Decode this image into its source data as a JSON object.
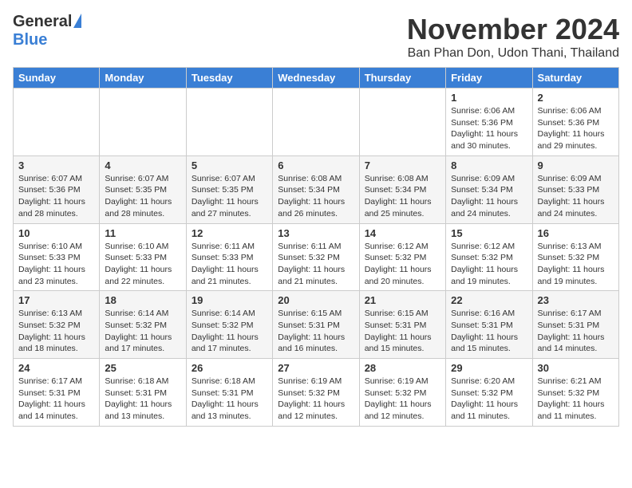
{
  "logo": {
    "general": "General",
    "blue": "Blue"
  },
  "title": "November 2024",
  "location": "Ban Phan Don, Udon Thani, Thailand",
  "weekdays": [
    "Sunday",
    "Monday",
    "Tuesday",
    "Wednesday",
    "Thursday",
    "Friday",
    "Saturday"
  ],
  "weeks": [
    [
      {
        "day": "",
        "info": ""
      },
      {
        "day": "",
        "info": ""
      },
      {
        "day": "",
        "info": ""
      },
      {
        "day": "",
        "info": ""
      },
      {
        "day": "",
        "info": ""
      },
      {
        "day": "1",
        "info": "Sunrise: 6:06 AM\nSunset: 5:36 PM\nDaylight: 11 hours\nand 30 minutes."
      },
      {
        "day": "2",
        "info": "Sunrise: 6:06 AM\nSunset: 5:36 PM\nDaylight: 11 hours\nand 29 minutes."
      }
    ],
    [
      {
        "day": "3",
        "info": "Sunrise: 6:07 AM\nSunset: 5:36 PM\nDaylight: 11 hours\nand 28 minutes."
      },
      {
        "day": "4",
        "info": "Sunrise: 6:07 AM\nSunset: 5:35 PM\nDaylight: 11 hours\nand 28 minutes."
      },
      {
        "day": "5",
        "info": "Sunrise: 6:07 AM\nSunset: 5:35 PM\nDaylight: 11 hours\nand 27 minutes."
      },
      {
        "day": "6",
        "info": "Sunrise: 6:08 AM\nSunset: 5:34 PM\nDaylight: 11 hours\nand 26 minutes."
      },
      {
        "day": "7",
        "info": "Sunrise: 6:08 AM\nSunset: 5:34 PM\nDaylight: 11 hours\nand 25 minutes."
      },
      {
        "day": "8",
        "info": "Sunrise: 6:09 AM\nSunset: 5:34 PM\nDaylight: 11 hours\nand 24 minutes."
      },
      {
        "day": "9",
        "info": "Sunrise: 6:09 AM\nSunset: 5:33 PM\nDaylight: 11 hours\nand 24 minutes."
      }
    ],
    [
      {
        "day": "10",
        "info": "Sunrise: 6:10 AM\nSunset: 5:33 PM\nDaylight: 11 hours\nand 23 minutes."
      },
      {
        "day": "11",
        "info": "Sunrise: 6:10 AM\nSunset: 5:33 PM\nDaylight: 11 hours\nand 22 minutes."
      },
      {
        "day": "12",
        "info": "Sunrise: 6:11 AM\nSunset: 5:33 PM\nDaylight: 11 hours\nand 21 minutes."
      },
      {
        "day": "13",
        "info": "Sunrise: 6:11 AM\nSunset: 5:32 PM\nDaylight: 11 hours\nand 21 minutes."
      },
      {
        "day": "14",
        "info": "Sunrise: 6:12 AM\nSunset: 5:32 PM\nDaylight: 11 hours\nand 20 minutes."
      },
      {
        "day": "15",
        "info": "Sunrise: 6:12 AM\nSunset: 5:32 PM\nDaylight: 11 hours\nand 19 minutes."
      },
      {
        "day": "16",
        "info": "Sunrise: 6:13 AM\nSunset: 5:32 PM\nDaylight: 11 hours\nand 19 minutes."
      }
    ],
    [
      {
        "day": "17",
        "info": "Sunrise: 6:13 AM\nSunset: 5:32 PM\nDaylight: 11 hours\nand 18 minutes."
      },
      {
        "day": "18",
        "info": "Sunrise: 6:14 AM\nSunset: 5:32 PM\nDaylight: 11 hours\nand 17 minutes."
      },
      {
        "day": "19",
        "info": "Sunrise: 6:14 AM\nSunset: 5:32 PM\nDaylight: 11 hours\nand 17 minutes."
      },
      {
        "day": "20",
        "info": "Sunrise: 6:15 AM\nSunset: 5:31 PM\nDaylight: 11 hours\nand 16 minutes."
      },
      {
        "day": "21",
        "info": "Sunrise: 6:15 AM\nSunset: 5:31 PM\nDaylight: 11 hours\nand 15 minutes."
      },
      {
        "day": "22",
        "info": "Sunrise: 6:16 AM\nSunset: 5:31 PM\nDaylight: 11 hours\nand 15 minutes."
      },
      {
        "day": "23",
        "info": "Sunrise: 6:17 AM\nSunset: 5:31 PM\nDaylight: 11 hours\nand 14 minutes."
      }
    ],
    [
      {
        "day": "24",
        "info": "Sunrise: 6:17 AM\nSunset: 5:31 PM\nDaylight: 11 hours\nand 14 minutes."
      },
      {
        "day": "25",
        "info": "Sunrise: 6:18 AM\nSunset: 5:31 PM\nDaylight: 11 hours\nand 13 minutes."
      },
      {
        "day": "26",
        "info": "Sunrise: 6:18 AM\nSunset: 5:31 PM\nDaylight: 11 hours\nand 13 minutes."
      },
      {
        "day": "27",
        "info": "Sunrise: 6:19 AM\nSunset: 5:32 PM\nDaylight: 11 hours\nand 12 minutes."
      },
      {
        "day": "28",
        "info": "Sunrise: 6:19 AM\nSunset: 5:32 PM\nDaylight: 11 hours\nand 12 minutes."
      },
      {
        "day": "29",
        "info": "Sunrise: 6:20 AM\nSunset: 5:32 PM\nDaylight: 11 hours\nand 11 minutes."
      },
      {
        "day": "30",
        "info": "Sunrise: 6:21 AM\nSunset: 5:32 PM\nDaylight: 11 hours\nand 11 minutes."
      }
    ]
  ]
}
